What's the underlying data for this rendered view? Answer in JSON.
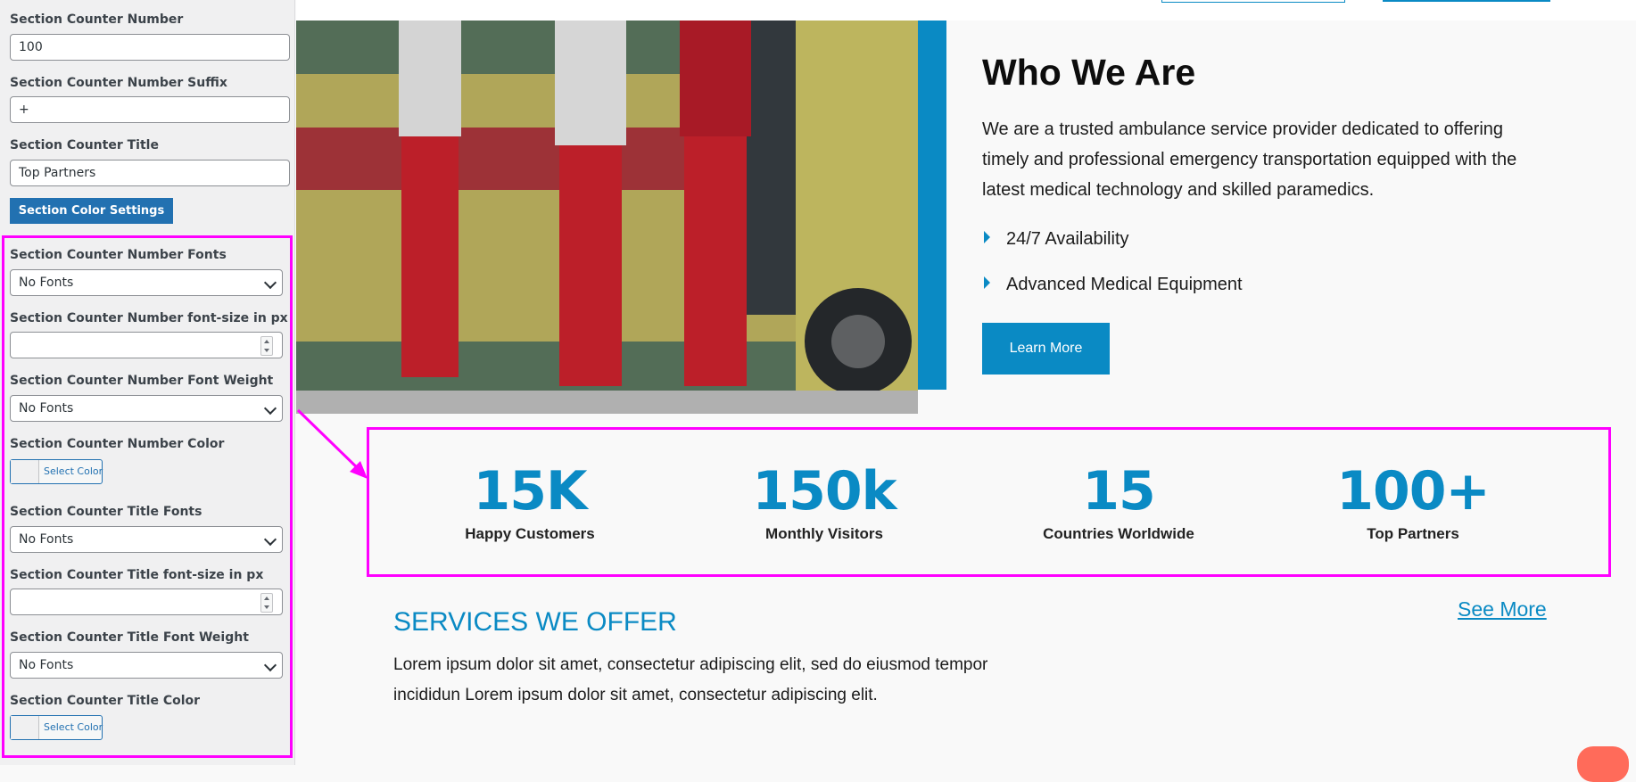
{
  "panel": {
    "counter_number_label": "Section Counter Number",
    "counter_number_value": "100",
    "suffix_label": "Section Counter Number Suffix",
    "suffix_value": "+",
    "title_label": "Section Counter Title",
    "title_value": "Top Partners",
    "color_settings_button": "Section Color Settings",
    "number_fonts_label": "Section Counter Number Fonts",
    "number_fonts_value": "No Fonts",
    "number_size_label": "Section Counter Number font-size in px",
    "number_weight_label": "Section Counter Number Font Weight",
    "number_weight_value": "No Fonts",
    "number_color_label": "Section Counter Number Color",
    "select_color": "Select Color",
    "title_fonts_label": "Section Counter Title Fonts",
    "title_fonts_value": "No Fonts",
    "title_size_label": "Section Counter Title font-size in px",
    "title_weight_label": "Section Counter Title Font Weight",
    "title_weight_value": "No Fonts",
    "title_color_label": "Section Counter Title Color"
  },
  "about": {
    "heading": "Who We Are",
    "description": "We are a trusted ambulance service provider dedicated to offering timely and professional emergency transportation equipped with the latest medical technology and skilled paramedics.",
    "bullets": [
      "24/7 Availability",
      "Advanced Medical Equipment"
    ],
    "button": "Learn More"
  },
  "stats": [
    {
      "number": "15K",
      "title": "Happy Customers"
    },
    {
      "number": "150k",
      "title": "Monthly Visitors"
    },
    {
      "number": "15",
      "title": "Countries Worldwide"
    },
    {
      "number": "100+",
      "title": "Top Partners"
    }
  ],
  "services": {
    "heading": "SERVICES WE OFFER",
    "description": "Lorem ipsum dolor sit amet, consectetur adipiscing elit, sed do eiusmod tempor incididun Lorem ipsum dolor sit amet, consectetur adipiscing elit.",
    "see_more": "See More"
  },
  "colors": {
    "accent": "#0a8ac4",
    "highlight": "#ff00ff",
    "admin_button": "#2271b1"
  }
}
